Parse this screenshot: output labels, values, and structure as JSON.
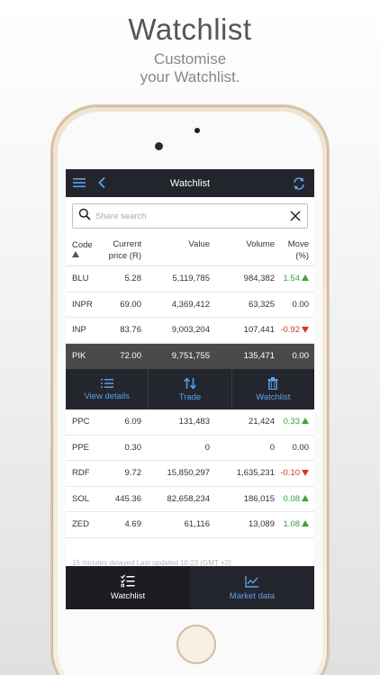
{
  "promo": {
    "headline": "Watchlist",
    "subline_1": "Customise",
    "subline_2": "your Watchlist."
  },
  "appbar": {
    "title": "Watchlist",
    "menu_icon": "hamburger-icon",
    "back_icon": "chevron-left-icon",
    "refresh_icon": "refresh-icon"
  },
  "search": {
    "placeholder": "Share search",
    "value": ""
  },
  "table": {
    "headers": {
      "code": "Code",
      "price_1": "Current",
      "price_2": "price (R)",
      "value": "Value",
      "volume": "Volume",
      "move_1": "Move",
      "move_2": "(%)"
    },
    "rows_top": [
      {
        "code": "BLU",
        "price": "5.28",
        "value": "5,119,785",
        "volume": "984,382",
        "move": "1.54",
        "dir": "up"
      },
      {
        "code": "INPR",
        "price": "69.00",
        "value": "4,369,412",
        "volume": "63,325",
        "move": "0.00",
        "dir": "flat"
      },
      {
        "code": "INP",
        "price": "83.76",
        "value": "9,003,204",
        "volume": "107,441",
        "move": "-0.92",
        "dir": "down"
      }
    ],
    "selected_row": {
      "code": "PIK",
      "price": "72.00",
      "value": "9,751,755",
      "volume": "135,471",
      "move": "0.00",
      "dir": "flat"
    },
    "rows_bottom": [
      {
        "code": "PPC",
        "price": "6.09",
        "value": "131,483",
        "volume": "21,424",
        "move": "0.33",
        "dir": "up"
      },
      {
        "code": "PPE",
        "price": "0.30",
        "value": "0",
        "volume": "0",
        "move": "0.00",
        "dir": "flat"
      },
      {
        "code": "RDF",
        "price": "9.72",
        "value": "15,850,297",
        "volume": "1,635,231",
        "move": "-0.10",
        "dir": "down"
      },
      {
        "code": "SOL",
        "price": "445.36",
        "value": "82,658,234",
        "volume": "186,015",
        "move": "0.08",
        "dir": "up"
      },
      {
        "code": "ZED",
        "price": "4.69",
        "value": "61,116",
        "volume": "13,089",
        "move": "1.08",
        "dir": "up"
      }
    ]
  },
  "row_actions": {
    "view_details": "View details",
    "trade": "Trade",
    "watchlist": "Watchlist"
  },
  "footer_note": "15 minutes delayed   Last updated 10:23 (GMT +2)",
  "bottom_nav": {
    "watchlist": "Watchlist",
    "market_data": "Market data"
  },
  "colors": {
    "bar": "#23252d",
    "accent": "#5aa2e8",
    "up": "#3fa13a",
    "down": "#d6342c",
    "selected_row": "#4a4a4a"
  }
}
